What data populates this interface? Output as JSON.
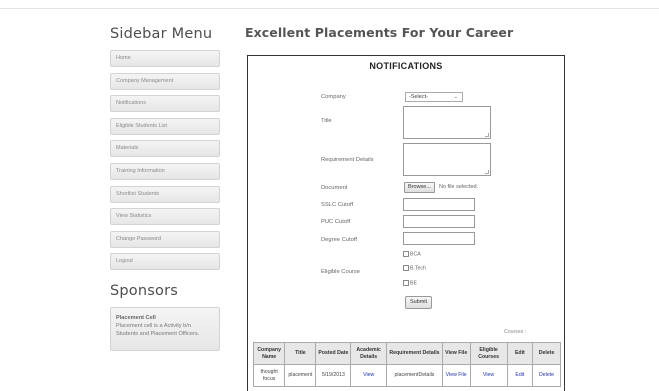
{
  "sidebar": {
    "title": "Sidebar Menu",
    "items": [
      {
        "label": "Home"
      },
      {
        "label": "Company Management"
      },
      {
        "label": "Notifications"
      },
      {
        "label": "Eligible Students List"
      },
      {
        "label": "Materials"
      },
      {
        "label": "Training Information"
      },
      {
        "label": "Shortlist Students"
      },
      {
        "label": "View Statistics"
      },
      {
        "label": "Change Password"
      },
      {
        "label": "Logout"
      }
    ]
  },
  "sponsors": {
    "title": "Sponsors",
    "name": "Placement Cell",
    "text": "Placement cell is a Activity b/n Students and Placement Officers."
  },
  "main": {
    "title": "Excellent Placements For Your Career"
  },
  "form": {
    "heading": "NOTIFICATIONS",
    "company_label": "Company",
    "company_selected": "-Select-",
    "title_label": "Title",
    "requirement_label": "Requirement Details",
    "document_label": "Document",
    "browse_label": "Browse...",
    "no_file_text": "No file selected.",
    "sslc_label": "SSLC Cutoff",
    "puc_label": "PUC Cutoff",
    "degree_label": "Degree Cutoff",
    "eligible_label": "Eligible Course",
    "courses": [
      "BCA",
      "B.Tech",
      "BE"
    ],
    "submit_label": "Submit",
    "courses_caption": "Courses :"
  },
  "table": {
    "headers": [
      "Company Name",
      "Title",
      "Posted Date",
      "Academic Details",
      "Requirement Details",
      "View File",
      "Eligible Courses",
      "Edit",
      "Delete"
    ],
    "rows": [
      [
        "thought focus",
        "placement",
        "5/19/2013",
        "View",
        "placementDetails",
        "View File",
        "View",
        "Edit",
        "Delete"
      ]
    ]
  }
}
